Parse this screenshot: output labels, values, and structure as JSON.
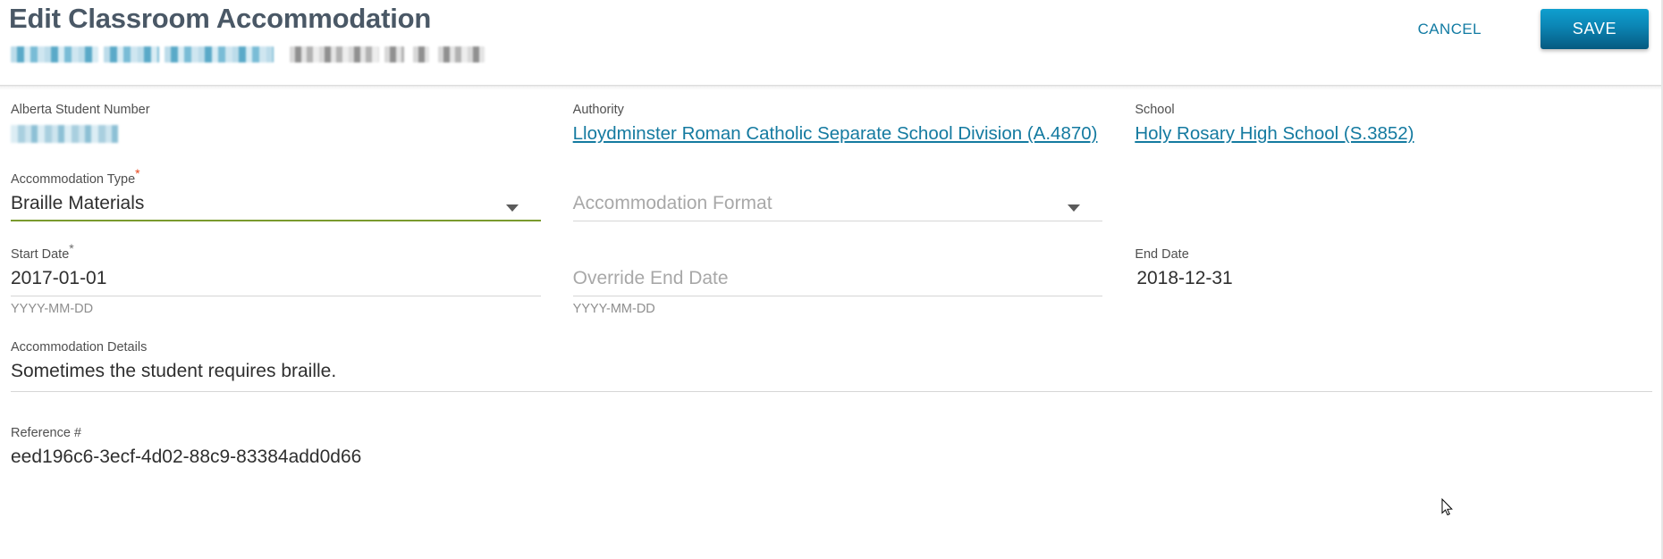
{
  "header": {
    "title": "Edit Classroom Accommodation",
    "subtitle_redacted": true,
    "cancel_label": "CANCEL",
    "save_label": "SAVE",
    "accent_link_color": "#127ba3",
    "save_gradient_top": "#0f9fcf",
    "save_gradient_bottom": "#065a80"
  },
  "form": {
    "alberta_student_number": {
      "label": "Alberta Student Number",
      "value_redacted": true
    },
    "authority": {
      "label": "Authority",
      "link_text": "Lloydminster Roman Catholic Separate School Division (A.4870)"
    },
    "school": {
      "label": "School",
      "link_text": "Holy Rosary High School (S.3852)"
    },
    "accommodation_type": {
      "label": "Accommodation Type",
      "required_marker": "*",
      "value": "Braille Materials",
      "underline_color": "#7a9a2e"
    },
    "accommodation_format": {
      "placeholder": "Accommodation Format",
      "value": ""
    },
    "start_date": {
      "label": "Start Date",
      "required_marker": "*",
      "value": "2017-01-01",
      "hint": "YYYY-MM-DD"
    },
    "override_end_date": {
      "placeholder": "Override End Date",
      "value": "",
      "hint": "YYYY-MM-DD"
    },
    "end_date": {
      "label": "End Date",
      "value": "2018-12-31"
    },
    "accommodation_details": {
      "label": "Accommodation Details",
      "value": "Sometimes the student requires braille."
    },
    "reference_number": {
      "label": "Reference #",
      "value": "eed196c6-3ecf-4d02-88c9-83384add0d66"
    }
  }
}
